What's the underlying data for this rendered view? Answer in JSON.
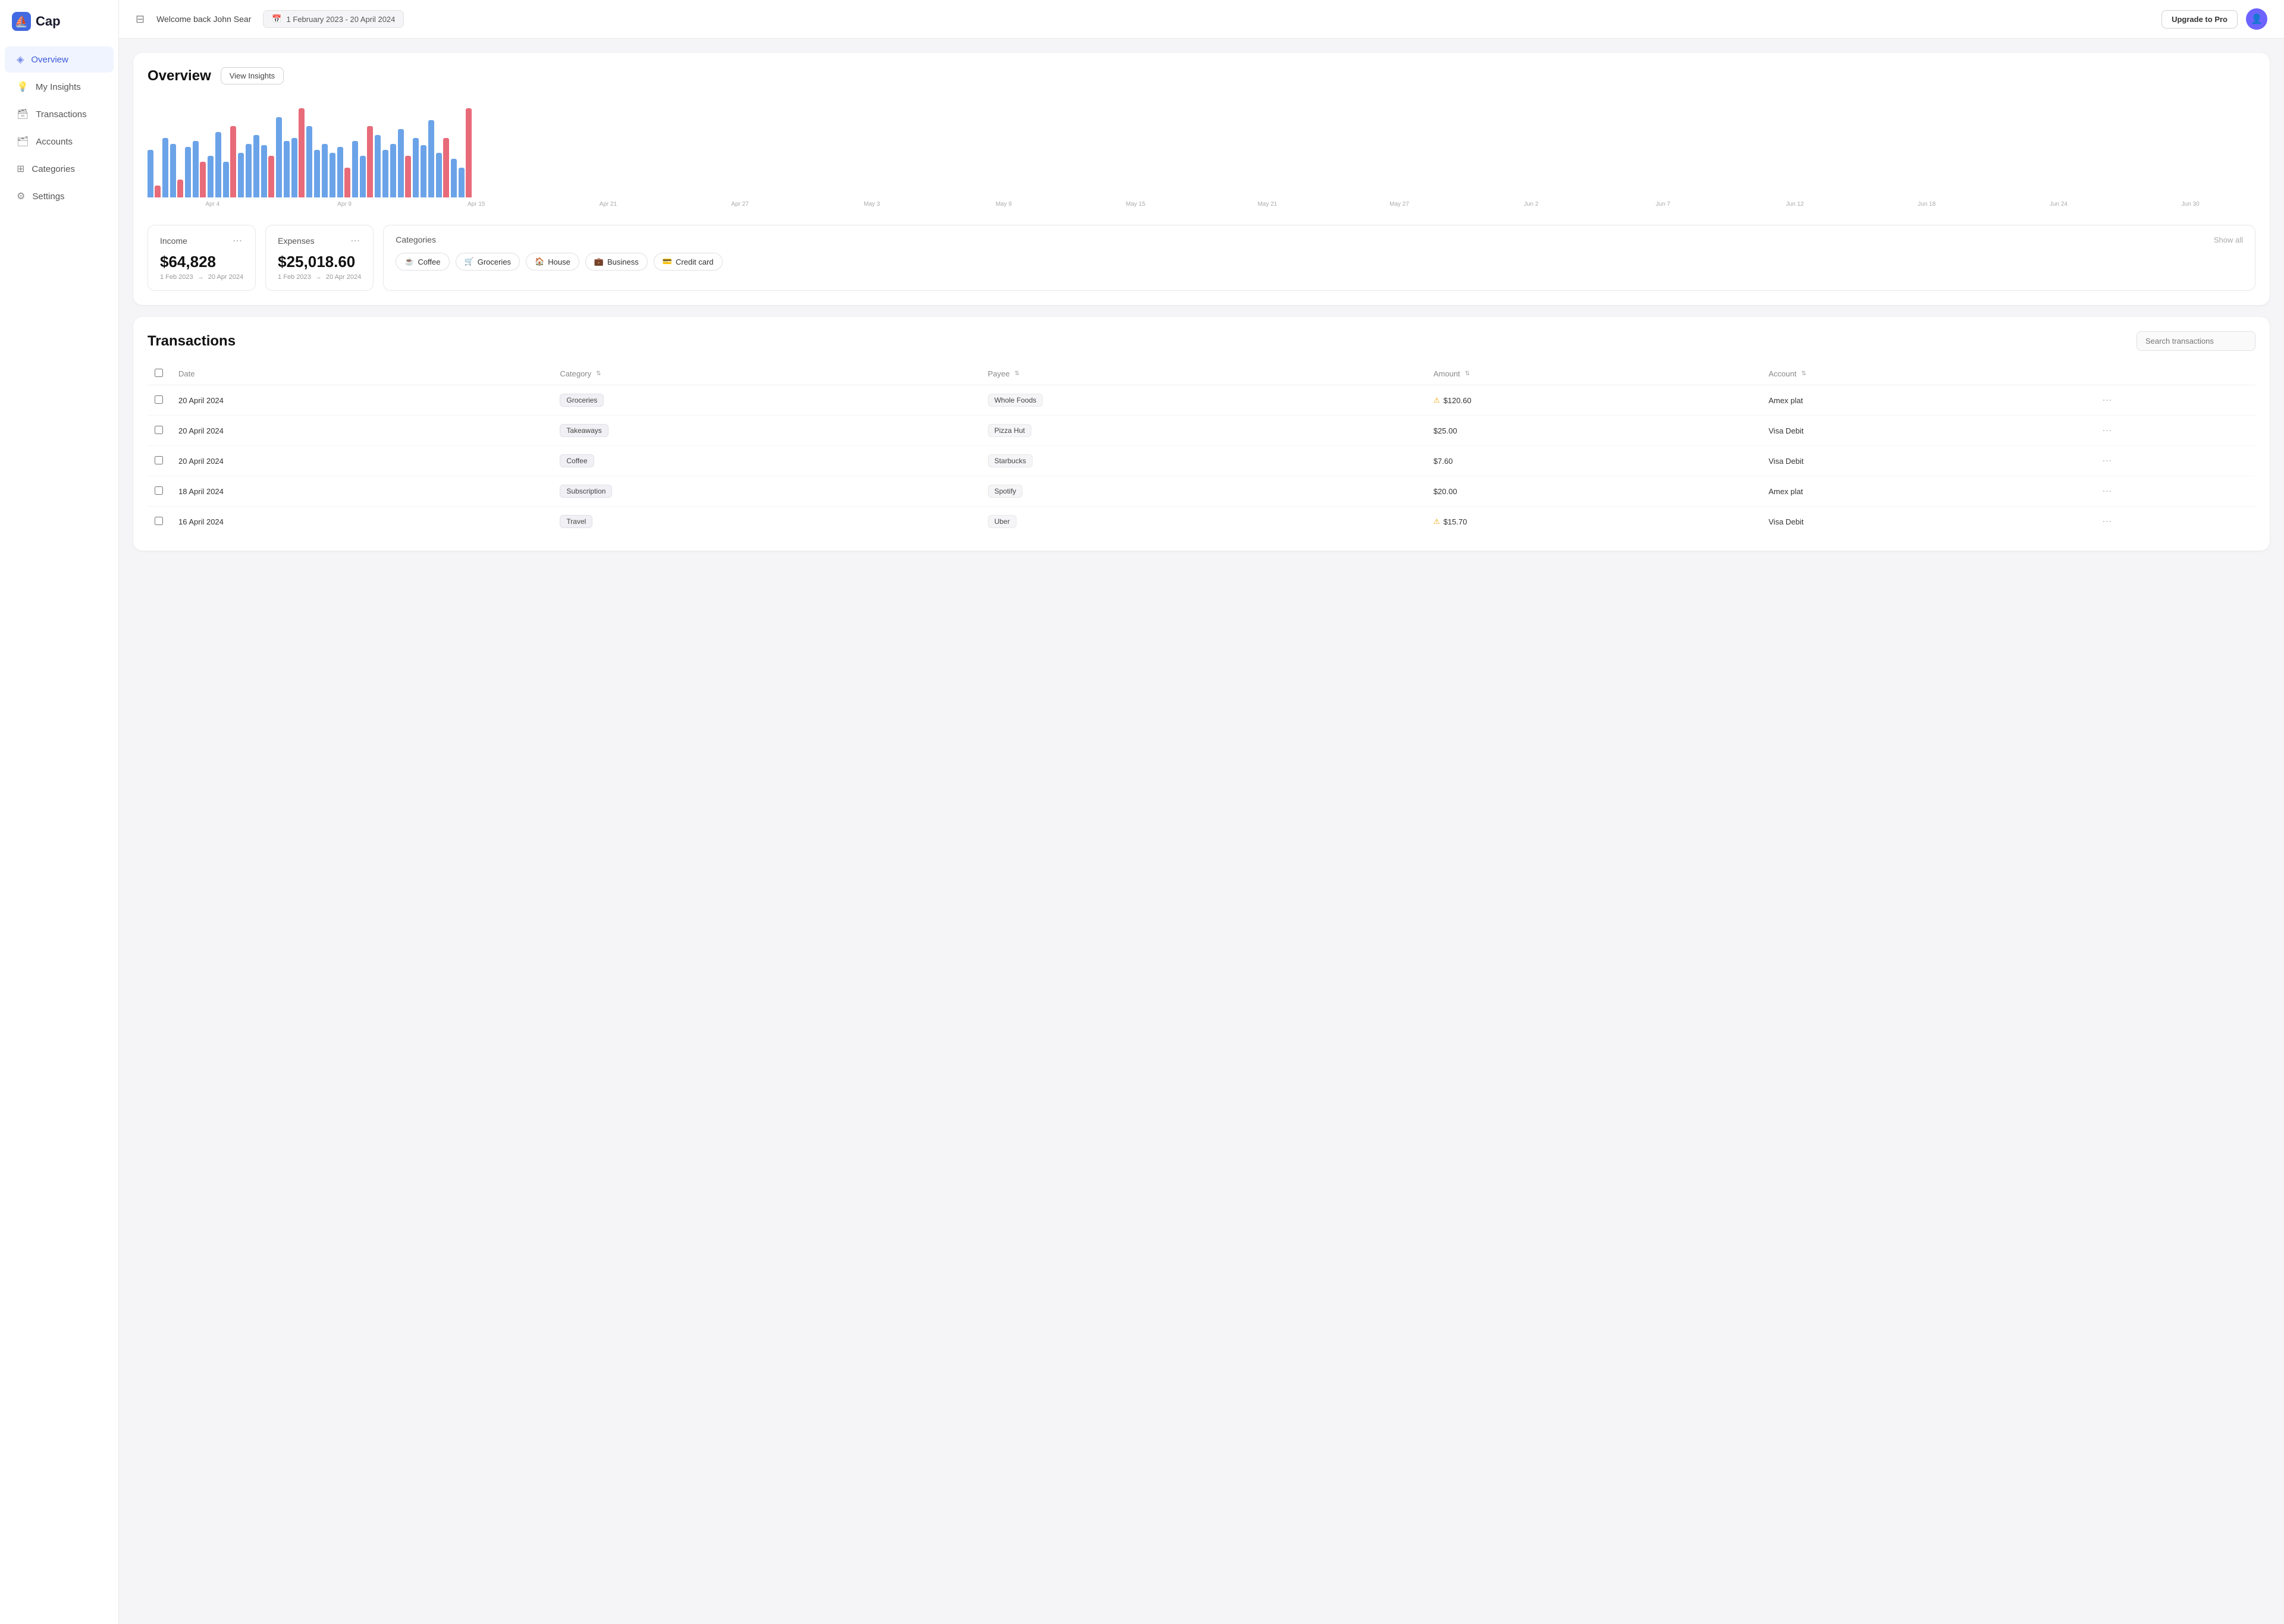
{
  "app": {
    "name": "Cap",
    "logo_symbol": "◀"
  },
  "header": {
    "sidebar_toggle_icon": "▦",
    "welcome": "Welcome back John Sear",
    "date_range": "1 February 2023 - 20 April 2024",
    "date_icon": "📅",
    "upgrade_label": "Upgrade to Pro",
    "avatar_icon": "👤"
  },
  "sidebar": {
    "items": [
      {
        "id": "overview",
        "label": "Overview",
        "icon": "◈",
        "active": true
      },
      {
        "id": "my-insights",
        "label": "My Insights",
        "icon": "💡",
        "active": false
      },
      {
        "id": "transactions",
        "label": "Transactions",
        "icon": "🗃",
        "active": false
      },
      {
        "id": "accounts",
        "label": "Accounts",
        "icon": "🗂",
        "active": false
      },
      {
        "id": "categories",
        "label": "Categories",
        "icon": "⊞",
        "active": false
      },
      {
        "id": "settings",
        "label": "Settings",
        "icon": "⚙",
        "active": false
      }
    ]
  },
  "overview": {
    "title": "Overview",
    "view_insights_label": "View Insights",
    "chart": {
      "bars": [
        {
          "label": "Apr 4",
          "blue": 80,
          "red": 20
        },
        {
          "label": "Apr 4",
          "blue": 100,
          "red": 0
        },
        {
          "label": "Apr 9",
          "blue": 90,
          "red": 30
        },
        {
          "label": "Apr 9",
          "blue": 85,
          "red": 0
        },
        {
          "label": "Apr 15",
          "blue": 95,
          "red": 60
        },
        {
          "label": "Apr 15",
          "blue": 70,
          "red": 0
        },
        {
          "label": "Apr 21",
          "blue": 110,
          "red": 0
        },
        {
          "label": "Apr 21",
          "blue": 60,
          "red": 120
        },
        {
          "label": "Apr 27",
          "blue": 75,
          "red": 0
        },
        {
          "label": "Apr 27",
          "blue": 90,
          "red": 0
        },
        {
          "label": "May 3",
          "blue": 105,
          "red": 0
        },
        {
          "label": "May 3",
          "blue": 88,
          "red": 70
        },
        {
          "label": "May 9",
          "blue": 135,
          "red": 0
        },
        {
          "label": "May 9",
          "blue": 95,
          "red": 0
        },
        {
          "label": "May 15",
          "blue": 100,
          "red": 150
        },
        {
          "label": "May 15",
          "blue": 120,
          "red": 0
        },
        {
          "label": "May 21",
          "blue": 80,
          "red": 0
        },
        {
          "label": "May 21",
          "blue": 90,
          "red": 0
        },
        {
          "label": "May 27",
          "blue": 75,
          "red": 0
        },
        {
          "label": "May 27",
          "blue": 85,
          "red": 50
        },
        {
          "label": "Jun 2",
          "blue": 95,
          "red": 0
        },
        {
          "label": "Jun 2",
          "blue": 70,
          "red": 120
        },
        {
          "label": "Jun 7",
          "blue": 105,
          "red": 0
        },
        {
          "label": "Jun 7",
          "blue": 80,
          "red": 0
        },
        {
          "label": "Jun 12",
          "blue": 90,
          "red": 0
        },
        {
          "label": "Jun 12",
          "blue": 115,
          "red": 70
        },
        {
          "label": "Jun 18",
          "blue": 100,
          "red": 0
        },
        {
          "label": "Jun 18",
          "blue": 88,
          "red": 0
        },
        {
          "label": "Jun 24",
          "blue": 130,
          "red": 0
        },
        {
          "label": "Jun 24",
          "blue": 75,
          "red": 100
        },
        {
          "label": "Jun 30",
          "blue": 65,
          "red": 0
        },
        {
          "label": "Jun 30",
          "blue": 50,
          "red": 150
        }
      ],
      "x_labels": [
        "Apr 4",
        "Apr 9",
        "Apr 15",
        "Apr 21",
        "Apr 27",
        "May 3",
        "May 9",
        "May 15",
        "May 21",
        "May 27",
        "Jun 2",
        "Jun 7",
        "Jun 12",
        "Jun 18",
        "Jun 24",
        "Jun 30"
      ]
    },
    "income": {
      "label": "Income",
      "value": "$64,828",
      "date_from": "1 Feb 2023",
      "date_to": "20 Apr 2024",
      "menu_icon": "⋯"
    },
    "expenses": {
      "label": "Expenses",
      "value": "$25,018.60",
      "date_from": "1 Feb 2023",
      "date_to": "20 Apr 2024",
      "menu_icon": "⋯"
    },
    "categories": {
      "label": "Categories",
      "show_all_label": "Show all",
      "chips": [
        {
          "id": "coffee",
          "icon": "☕",
          "label": "Coffee"
        },
        {
          "id": "groceries",
          "icon": "🛒",
          "label": "Groceries"
        },
        {
          "id": "house",
          "icon": "🏠",
          "label": "House"
        },
        {
          "id": "business",
          "icon": "💼",
          "label": "Business"
        },
        {
          "id": "credit-card",
          "icon": "💳",
          "label": "Credit card"
        }
      ]
    }
  },
  "transactions": {
    "title": "Transactions",
    "search_placeholder": "Search transactions",
    "columns": [
      {
        "id": "date",
        "label": "Date",
        "sortable": false
      },
      {
        "id": "category",
        "label": "Category",
        "sortable": true
      },
      {
        "id": "payee",
        "label": "Payee",
        "sortable": true
      },
      {
        "id": "amount",
        "label": "Amount",
        "sortable": true
      },
      {
        "id": "account",
        "label": "Account",
        "sortable": true
      }
    ],
    "rows": [
      {
        "date": "20 April 2024",
        "category": "Groceries",
        "payee": "Whole Foods",
        "amount": "$120.60",
        "amount_warning": true,
        "account": "Amex plat"
      },
      {
        "date": "20 April 2024",
        "category": "Takeaways",
        "payee": "Pizza Hut",
        "amount": "$25.00",
        "amount_warning": false,
        "account": "Visa Debit"
      },
      {
        "date": "20 April 2024",
        "category": "Coffee",
        "payee": "Starbucks",
        "amount": "$7.60",
        "amount_warning": false,
        "account": "Visa Debit"
      },
      {
        "date": "18 April 2024",
        "category": "Subscription",
        "payee": "Spotify",
        "amount": "$20.00",
        "amount_warning": false,
        "account": "Amex plat"
      },
      {
        "date": "16 April 2024",
        "category": "Travel",
        "payee": "Uber",
        "amount": "$15.70",
        "amount_warning": true,
        "account": "Visa Debit"
      }
    ],
    "row_menu_icon": "⋯"
  }
}
